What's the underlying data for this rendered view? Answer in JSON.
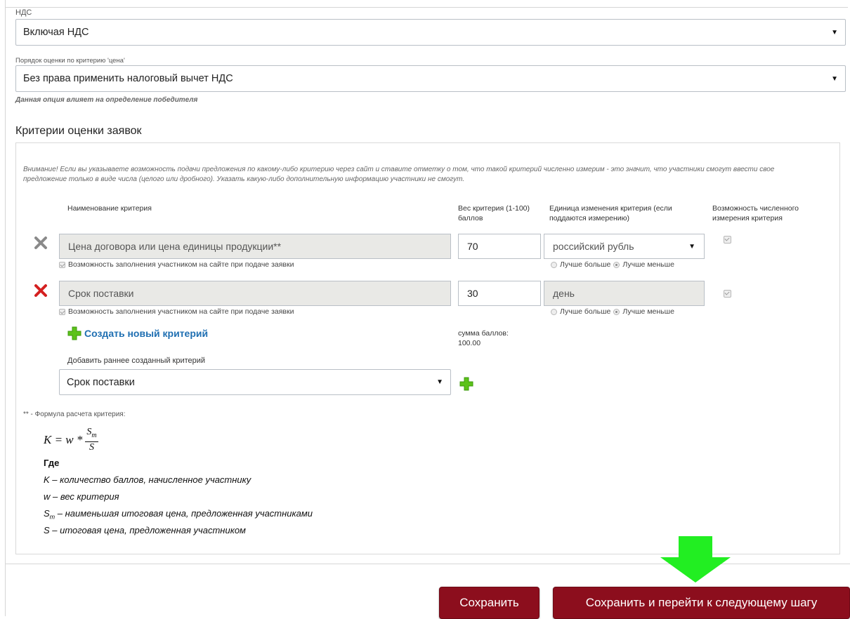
{
  "vat": {
    "label": "НДС",
    "value": "Включая НДС"
  },
  "price_order": {
    "label": "Порядок оценки по критерию 'цена'",
    "value": "Без права применить налоговый вычет НДС",
    "hint": "Данная опция влияет на определение победителя"
  },
  "criteria": {
    "title": "Критерии оценки заявок",
    "warning": "Внимание! Если вы указываете возможность подачи предложения по какому-либо критерию через сайт и ставите отметку о том, что такой критерий численно измерим - это значит, что участники смогут ввести свое предложение только в виде числа (целого или дробного). Указать какую-либо дополнительную информацию участники не смогут.",
    "headers": {
      "name": "Наименование критерия",
      "weight": "Вес критерия (1-100) баллов",
      "unit": "Единица изменения критерия (если поддаются измерению)",
      "numeric": "Возможность численного измерения критерия"
    },
    "rows": [
      {
        "name": "Цена договора или цена единицы продукции**",
        "weight": "70",
        "unit": "российский рубль",
        "participant_fill": "Возможность заполнения участником на сайте при подаче заявки",
        "better_more": "Лучше больше",
        "better_less": "Лучше меньше",
        "delete_color": "#8a8a8a"
      },
      {
        "name": "Срок поставки",
        "weight": "30",
        "unit": "день",
        "participant_fill": "Возможность заполнения участником на сайте при подаче заявки",
        "better_more": "Лучше больше",
        "better_less": "Лучше меньше",
        "delete_color": "#d42020"
      }
    ],
    "create_new": "Создать новый критерий",
    "sum_label": "сумма баллов:",
    "sum_value": "100.00",
    "add_existing_label": "Добавить раннее созданный критерий",
    "add_existing_value": "Срок поставки"
  },
  "formula": {
    "title": "** - Формула расчета критерия:",
    "lhs": "K = w *",
    "numerator": "S",
    "numerator_sub": "m",
    "denominator": "S",
    "where": "Где",
    "lines": [
      "K – количество баллов, начисленное участнику",
      "w – вес критерия",
      "S",
      "m",
      "– наименьшая итоговая цена, предложенная участниками",
      "S – итоговая цена, предложенная участником"
    ]
  },
  "buttons": {
    "save": "Сохранить",
    "save_next": "Сохранить и перейти к следующему шагу"
  },
  "colors": {
    "button": "#8c0e1d",
    "arrow": "#22ee22",
    "link": "#1f6fb2"
  }
}
